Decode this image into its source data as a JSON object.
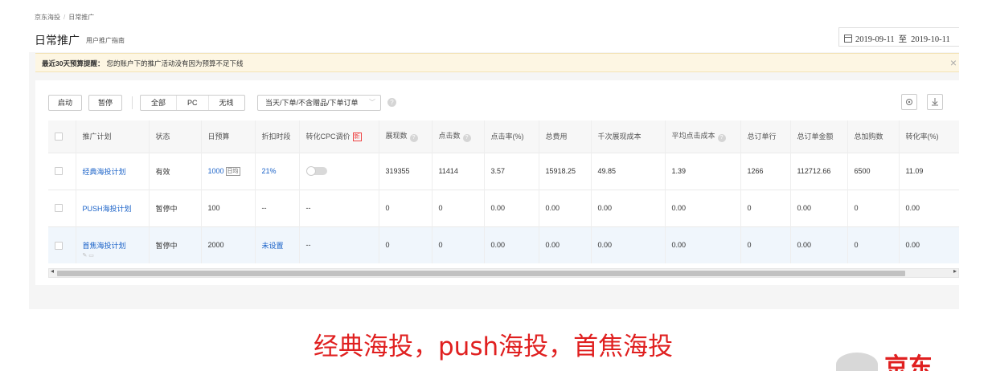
{
  "breadcrumb": {
    "root": "京东海投",
    "current": "日常推广"
  },
  "header": {
    "title": "日常推广",
    "subtitle": "用户推广指南"
  },
  "date_range": {
    "start": "2019-09-11",
    "separator": "至",
    "end": "2019-10-11"
  },
  "notice": {
    "title": "最近30天预算提醒：",
    "text": "您的账户下的推广活动没有因为预算不足下线",
    "close": "×"
  },
  "toolbar": {
    "start_label": "启动",
    "pause_label": "暂停",
    "filters": [
      "全部",
      "PC",
      "无线"
    ],
    "order_select": "当天/下单/不含赠品/下单订单",
    "help": "?"
  },
  "table": {
    "columns": [
      "推广计划",
      "状态",
      "日预算",
      "折扣时段",
      "转化CPC调价",
      "展现数",
      "点击数",
      "点击率(%)",
      "总费用",
      "千次展现成本",
      "平均点击成本",
      "总订单行",
      "总订单金额",
      "总加购数",
      "转化率(%)"
    ],
    "new_tag": "新",
    "daily_tag": "日均",
    "rows": [
      {
        "plan": "经典海投计划",
        "status": "有效",
        "budget": "1000",
        "discount": "21%",
        "cpc": "",
        "impressions": "319355",
        "clicks": "11414",
        "ctr": "3.57",
        "cost": "15918.25",
        "cpm": "49.85",
        "cpc_avg": "1.39",
        "orders": "1266",
        "order_amount": "112712.66",
        "carts": "6500",
        "conv": "11.09"
      },
      {
        "plan": "PUSH海投计划",
        "status": "暂停中",
        "budget": "100",
        "discount": "--",
        "cpc": "--",
        "impressions": "0",
        "clicks": "0",
        "ctr": "0.00",
        "cost": "0.00",
        "cpm": "0.00",
        "cpc_avg": "0.00",
        "orders": "0",
        "order_amount": "0.00",
        "carts": "0",
        "conv": "0.00"
      },
      {
        "plan": "首焦海投计划",
        "status": "暂停中",
        "budget": "2000",
        "discount": "未设置",
        "cpc": "--",
        "impressions": "0",
        "clicks": "0",
        "ctr": "0.00",
        "cost": "0.00",
        "cpm": "0.00",
        "cpc_avg": "0.00",
        "orders": "0",
        "order_amount": "0.00",
        "carts": "0",
        "conv": "0.00"
      }
    ]
  },
  "caption": {
    "part1": "经典海投，",
    "part2": "push",
    "part3": "海投，首焦海投"
  },
  "logo": {
    "text": "京东"
  },
  "colors": {
    "link": "#1a62c8",
    "caption": "#e02020",
    "notice_bg": "#fdf6e3"
  }
}
